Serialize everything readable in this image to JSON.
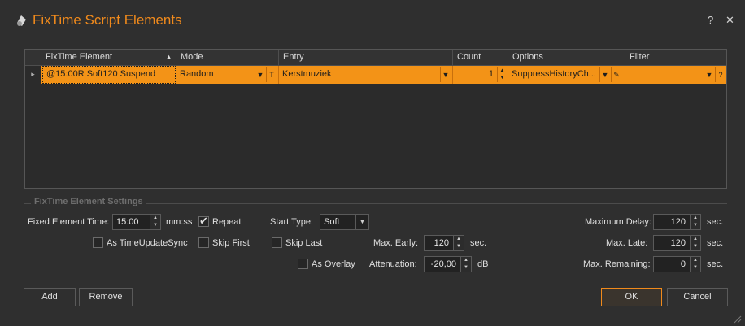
{
  "window": {
    "title": "FixTime Script Elements",
    "help_label": "?",
    "close_label": "✕"
  },
  "grid": {
    "columns": [
      "FixTime Element",
      "Mode",
      "Entry",
      "Count",
      "Options",
      "Filter"
    ],
    "sort_indicator": "▲",
    "row_marker": "▸",
    "rows": [
      {
        "element": "@15:00R Soft120 Suspend",
        "mode": "Random",
        "mode_btn": "T",
        "entry": "Kerstmuziek",
        "count": "1",
        "options": "SuppressHistoryCh...",
        "filter": "",
        "filter_btn": "?"
      }
    ]
  },
  "settings": {
    "group_title": "FixTime Element Settings",
    "fixed_time_label": "Fixed Element Time:",
    "fixed_time_value": "15:00",
    "fixed_time_unit": "mm:ss",
    "repeat_label": "Repeat",
    "as_timeupdatesync_label": "As TimeUpdateSync",
    "skip_first_label": "Skip First",
    "skip_last_label": "Skip Last",
    "as_overlay_label": "As Overlay",
    "start_type_label": "Start Type:",
    "start_type_value": "Soft",
    "max_early_label": "Max. Early:",
    "max_early_value": "120",
    "max_early_unit": "sec.",
    "attenuation_label": "Attenuation:",
    "attenuation_value": "-20,00",
    "attenuation_unit": "dB",
    "max_delay_label": "Maximum Delay:",
    "max_delay_value": "120",
    "max_delay_unit": "sec.",
    "max_late_label": "Max. Late:",
    "max_late_value": "120",
    "max_late_unit": "sec.",
    "max_remaining_label": "Max. Remaining:",
    "max_remaining_value": "0",
    "max_remaining_unit": "sec."
  },
  "buttons": {
    "add": "Add",
    "remove": "Remove",
    "ok": "OK",
    "cancel": "Cancel"
  },
  "colors": {
    "accent": "#f08a1c",
    "selected_row": "#f39317",
    "background": "#2f2f2f"
  }
}
